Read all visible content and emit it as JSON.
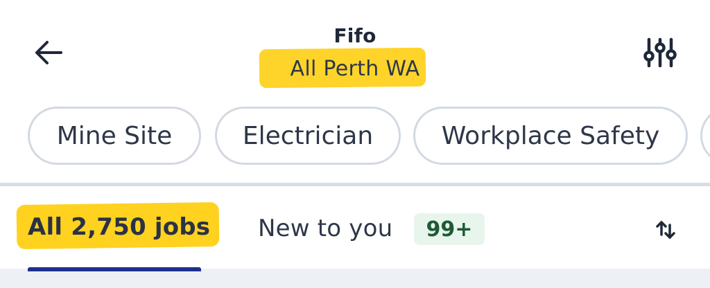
{
  "header": {
    "title": "Fifo",
    "subtitle": "All Perth WA",
    "back_icon": "arrow-left-icon",
    "filter_icon": "sliders-icon"
  },
  "chips": [
    {
      "label": "Mine Site"
    },
    {
      "label": "Electrician"
    },
    {
      "label": "Workplace Safety"
    }
  ],
  "tabs": {
    "all_label": "All 2,750 jobs",
    "new_label": "New to you",
    "new_badge": "99+",
    "sort_icon": "sort-arrows-icon"
  },
  "colors": {
    "highlight": "#ffd21f",
    "active_tab_underline": "#1e2f8e",
    "badge_bg": "#e8f5ec",
    "badge_text": "#1f5a36",
    "chip_border": "#d3d9e1"
  }
}
